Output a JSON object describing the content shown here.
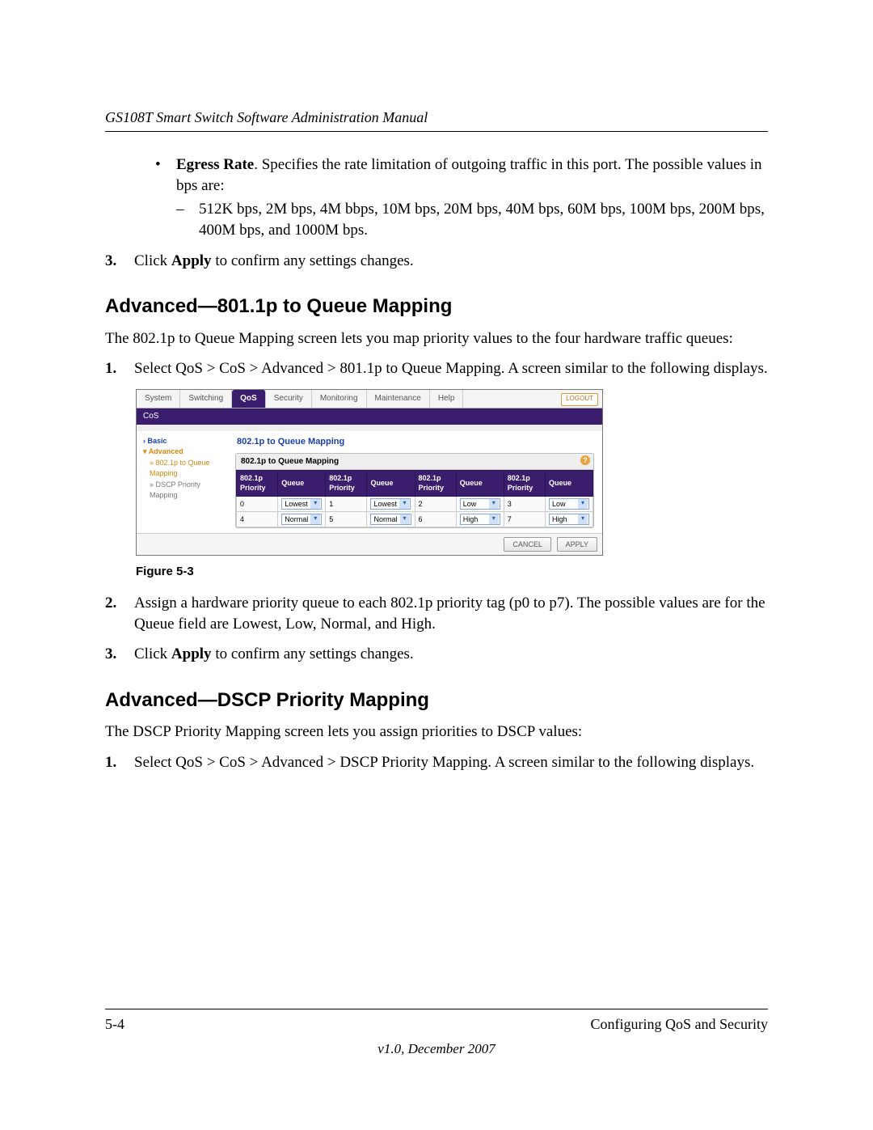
{
  "header": {
    "running": "GS108T Smart Switch Software Administration Manual"
  },
  "body": {
    "bullet": {
      "lead_bold": "Egress Rate",
      "lead_rest": ". Specifies the rate limitation of outgoing traffic in this port. The possible values in bps are:",
      "dash": "512K bps, 2M bps, 4M bbps, 10M bps, 20M bps, 40M bps, 60M bps, 100M bps, 200M bps, 400M bps, and 1000M bps."
    },
    "step3a": {
      "num": "3.",
      "pre": "Click ",
      "bold": "Apply",
      "post": " to confirm any settings changes."
    },
    "h2a": "Advanced—801.1p to Queue Mapping",
    "para_a": "The 802.1p to Queue Mapping screen lets you map priority values to the four hardware traffic queues:",
    "step1a": {
      "num": "1.",
      "text": "Select QoS > CoS > Advanced > 801.1p to Queue Mapping. A screen similar to the following displays."
    },
    "fig_caption": "Figure 5-3",
    "step2a": {
      "num": "2.",
      "text": "Assign a hardware priority queue to each 802.1p priority tag (p0 to p7). The possible values are for the Queue field are Lowest, Low, Normal, and High."
    },
    "step3b": {
      "num": "3.",
      "pre": "Click ",
      "bold": "Apply",
      "post": " to confirm any settings changes."
    },
    "h2b": "Advanced—DSCP Priority Mapping",
    "para_b": "The DSCP Priority Mapping screen lets you assign priorities to DSCP values:",
    "step1b": {
      "num": "1.",
      "text": "Select QoS > CoS > Advanced > DSCP Priority Mapping. A screen similar to the following displays."
    }
  },
  "screenshot": {
    "tabs": [
      "System",
      "Switching",
      "QoS",
      "Security",
      "Monitoring",
      "Maintenance",
      "Help"
    ],
    "active_tab_index": 2,
    "logout": "LOGOUT",
    "subbar": "CoS",
    "nav": {
      "basic": "Basic",
      "advanced": "Advanced",
      "item1a": "» 802.1p to Queue",
      "item1b": "Mapping",
      "item2a": "» DSCP Priority",
      "item2b": "Mapping"
    },
    "panel_title": "802.1p to Queue Mapping",
    "panel_box_title": "802.1p to Queue Mapping",
    "col_priority": "802.1p Priority",
    "col_queue": "Queue",
    "rows": [
      {
        "p": "0",
        "q": "Lowest"
      },
      {
        "p": "1",
        "q": "Lowest"
      },
      {
        "p": "2",
        "q": "Low"
      },
      {
        "p": "3",
        "q": "Low"
      },
      {
        "p": "4",
        "q": "Normal"
      },
      {
        "p": "5",
        "q": "Normal"
      },
      {
        "p": "6",
        "q": "High"
      },
      {
        "p": "7",
        "q": "High"
      }
    ],
    "btn_cancel": "CANCEL",
    "btn_apply": "APPLY"
  },
  "footer": {
    "page_num": "5-4",
    "section": "Configuring QoS and Security",
    "version": "v1.0, December 2007"
  }
}
